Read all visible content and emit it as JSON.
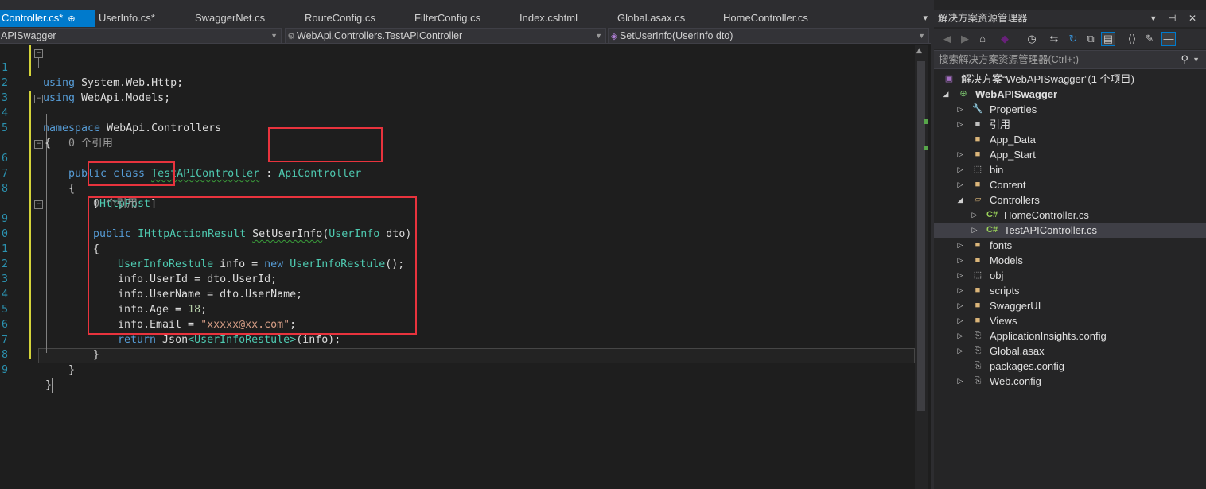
{
  "editor": {
    "tabs": [
      {
        "label": "Controller.cs*",
        "pin": "⊕"
      },
      {
        "label": "UserInfo.cs*"
      },
      {
        "label": "SwaggerNet.cs"
      },
      {
        "label": "RouteConfig.cs"
      },
      {
        "label": "FilterConfig.cs"
      },
      {
        "label": "Index.cshtml"
      },
      {
        "label": "Global.asax.cs"
      },
      {
        "label": "HomeController.cs"
      }
    ],
    "tab_overflow": "▾",
    "nav": {
      "project": "APISwagger",
      "class": "WebApi.Controllers.TestAPIController",
      "member": "SetUserInfo(UserInfo dto)"
    },
    "line_numbers": [
      "1",
      "2",
      "3",
      "4",
      "5",
      "",
      "6",
      "7",
      "8",
      "",
      "9",
      "0",
      "1",
      "2",
      "3",
      "4",
      "5",
      "6",
      "7",
      "8",
      "9"
    ],
    "code": {
      "l1_kw": "using",
      "l1_rest": " System.Web.Http;",
      "l2_kw": "using",
      "l2_rest": " WebApi.Models;",
      "l4_kw": "namespace",
      "l4_rest": " WebApi.Controllers",
      "l5": "{",
      "l_ref1": "0 个引用",
      "l6_kw": "public class",
      "l6_sp": " ",
      "l6_ty": "TestAPIController",
      "l6_colon": " : ",
      "l6_base": "ApiController",
      "l7": "{",
      "l8_open": "[",
      "l8_attr": "HttpPost",
      "l8_close": "]",
      "l_ref2": "0 个引用",
      "l9_kw": "public",
      "l9_sp": " ",
      "l9_ty": "IHttpActionResult",
      "l9_sp2": " ",
      "l9_name": "SetUserInfo",
      "l9_paren": "(",
      "l9_pty": "UserInfo",
      "l9_rest": " dto)",
      "l10": "{",
      "l11_ty": "UserInfoRestule",
      "l11_mid": " info = ",
      "l11_kw": "new",
      "l11_sp": " ",
      "l11_ty2": "UserInfoRestule",
      "l11_end": "();",
      "l12": "info.UserId = dto.UserId;",
      "l13": "info.UserName = dto.UserName;",
      "l14_a": "info.Age = ",
      "l14_num": "18",
      "l14_b": ";",
      "l15_a": "info.Email = ",
      "l15_str": "\"xxxxx@xx.com\"",
      "l15_b": ";",
      "l16_kw": "return",
      "l16_a": " Json",
      "l16_lt": "<",
      "l16_ty": "UserInfoRestule",
      "l16_gt": ">",
      "l16_b": "(info);",
      "l17": "}",
      "l18": "}",
      "l19": "}"
    }
  },
  "solution_explorer": {
    "title": "解决方案资源管理器",
    "title_buttons": "▾ ⊣ ✕",
    "search_placeholder": "搜索解决方案资源管理器(Ctrl+;)",
    "toolbar_icons": [
      "back-icon",
      "forward-icon",
      "home-icon",
      "vs-icon",
      "history-icon",
      "sync-icon",
      "refresh-icon",
      "collapse-icon",
      "show-all-files-icon",
      "code-view-icon",
      "properties-icon",
      "preview-icon"
    ],
    "tree": [
      {
        "label": "解决方案“WebAPISwagger”(1 个项目)"
      },
      {
        "label": "WebAPISwagger"
      },
      {
        "label": "Properties"
      },
      {
        "label": "引用"
      },
      {
        "label": "App_Data"
      },
      {
        "label": "App_Start"
      },
      {
        "label": "bin"
      },
      {
        "label": "Content"
      },
      {
        "label": "Controllers"
      },
      {
        "label": "HomeController.cs"
      },
      {
        "label": "TestAPIController.cs"
      },
      {
        "label": "fonts"
      },
      {
        "label": "Models"
      },
      {
        "label": "obj"
      },
      {
        "label": "scripts"
      },
      {
        "label": "SwaggerUI"
      },
      {
        "label": "Views"
      },
      {
        "label": "ApplicationInsights.config"
      },
      {
        "label": "Global.asax"
      },
      {
        "label": "packages.config"
      },
      {
        "label": "Web.config"
      }
    ]
  },
  "colors": {
    "accent": "#007acc",
    "keyword": "#569cd6",
    "type": "#4ec9b0",
    "string": "#d69d85",
    "highlight_box": "#e8333d"
  }
}
